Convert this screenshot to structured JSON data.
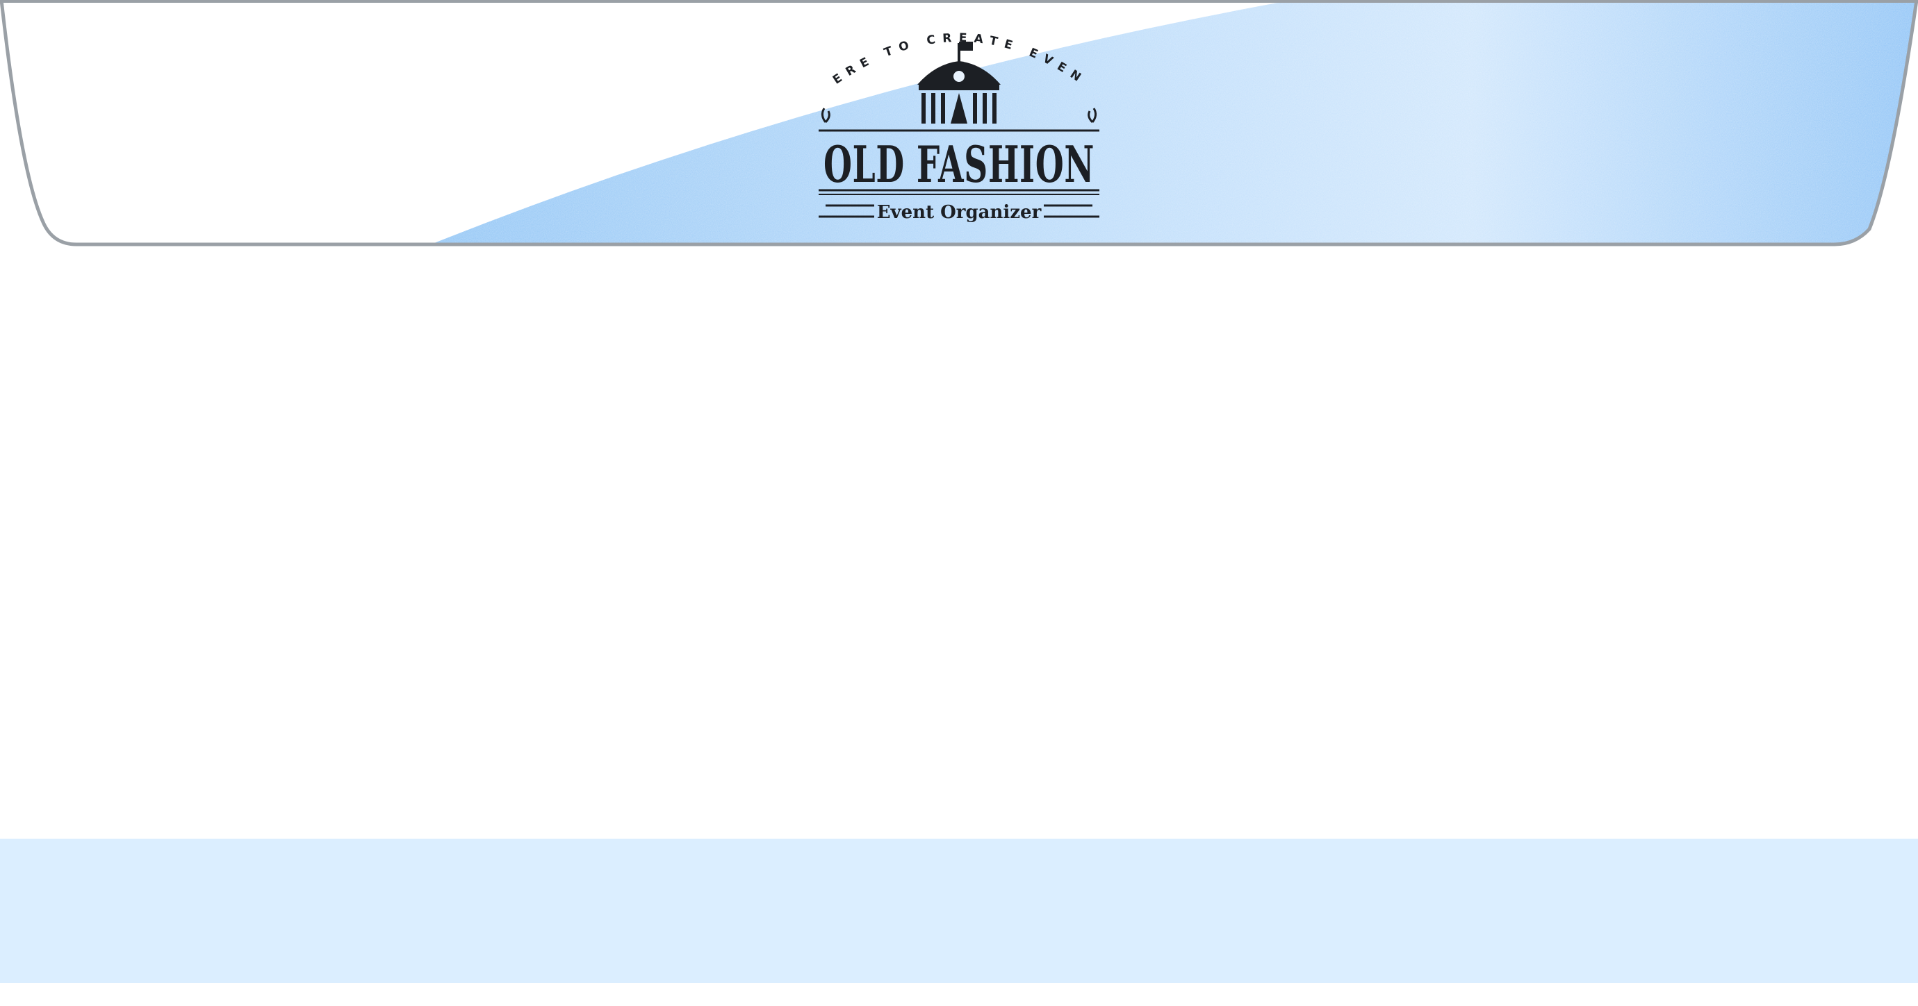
{
  "logo": {
    "arc_text": "HERE TO CREATE EVENT",
    "title": "OLD FASHION",
    "subtitle": "Event Organizer"
  },
  "colors": {
    "header_blue": "#9fcdf7",
    "header_blue_light": "#d8ecfd",
    "footer_band": "#dbeeff",
    "outline": "#9aa0a6",
    "logo_ink": "#1c1f24"
  },
  "icons": {
    "logo_building": "circus-tent-icon",
    "logo_flag": "flag-icon",
    "logo_laurels": "laurel-icon"
  }
}
